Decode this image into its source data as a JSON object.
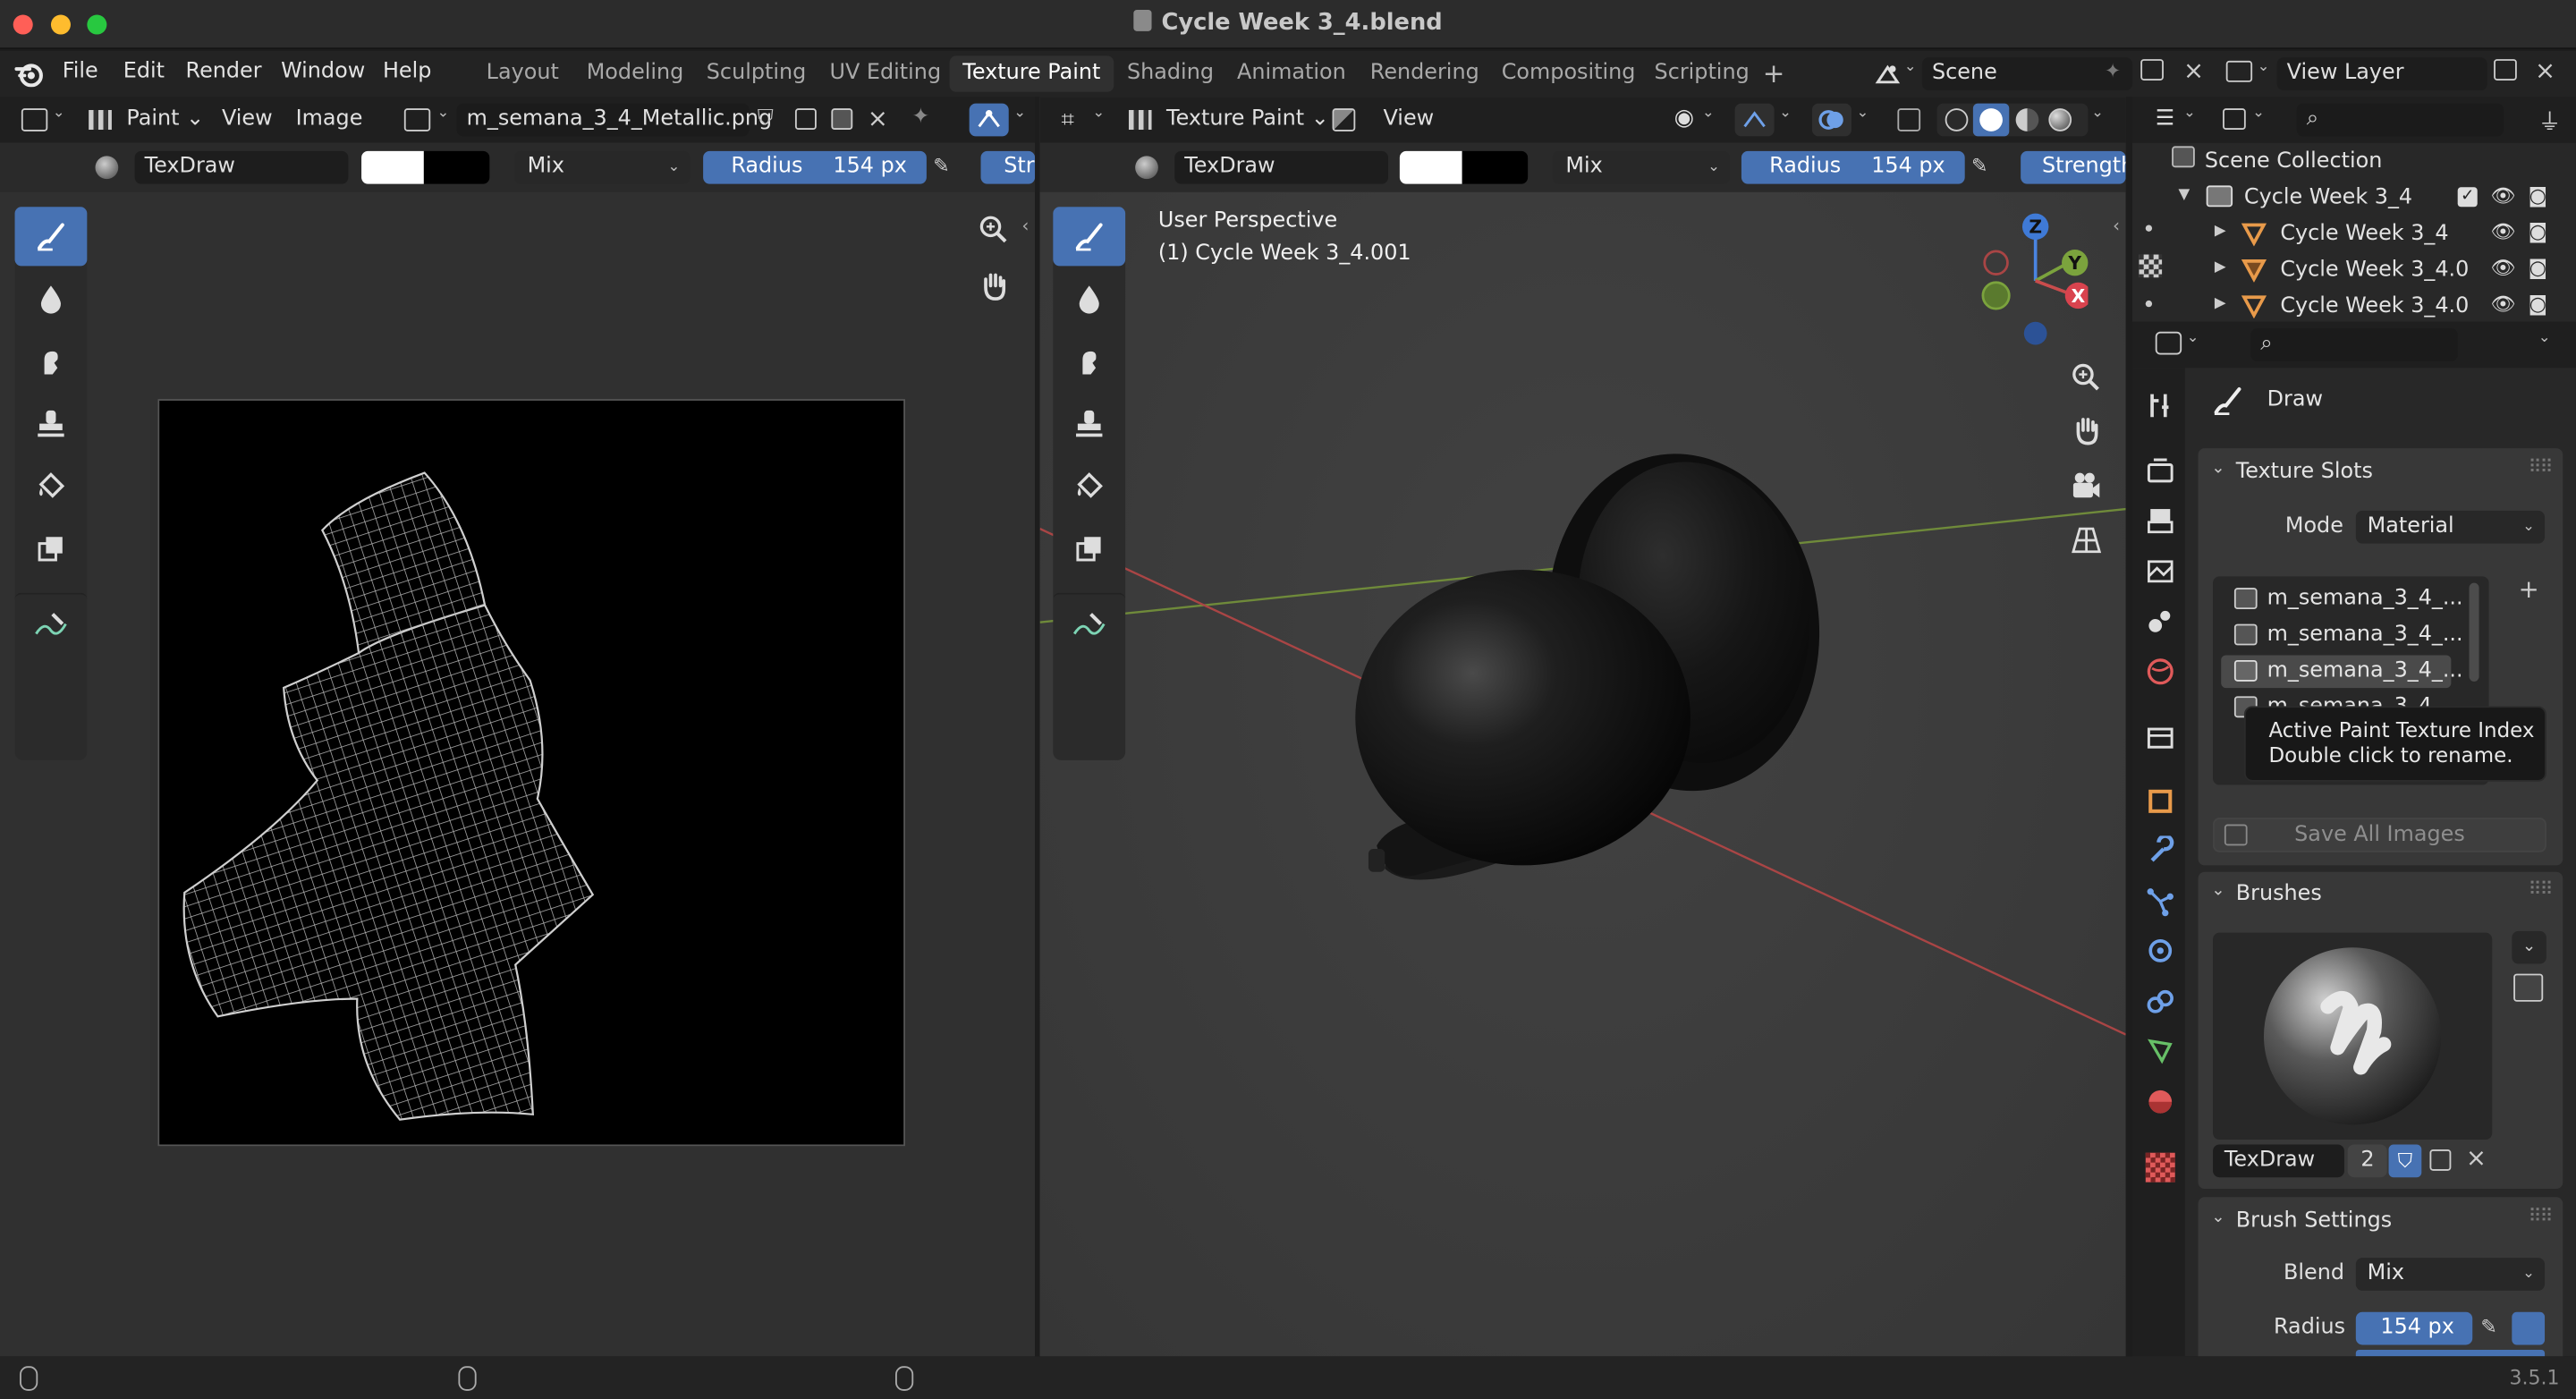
{
  "window": {
    "title": "Cycle Week 3_4.blend"
  },
  "menu": [
    "File",
    "Edit",
    "Render",
    "Window",
    "Help"
  ],
  "workspaces": [
    {
      "label": "Layout"
    },
    {
      "label": "Modeling"
    },
    {
      "label": "Sculpting"
    },
    {
      "label": "UV Editing"
    },
    {
      "label": "Texture Paint",
      "active": true
    },
    {
      "label": "Shading"
    },
    {
      "label": "Animation"
    },
    {
      "label": "Rendering"
    },
    {
      "label": "Compositing"
    },
    {
      "label": "Scripting"
    }
  ],
  "scene": {
    "name": "Scene"
  },
  "view_layer": {
    "name": "View Layer"
  },
  "image_editor": {
    "mode": "Paint",
    "menus": [
      "View",
      "Image"
    ],
    "image_name": "m_semana_3_4_Metallic.png",
    "brush": "TexDraw",
    "blend": "Mix",
    "radius_label": "Radius",
    "radius_value": "154 px",
    "strength_label": "Str"
  },
  "viewport": {
    "mode": "Texture Paint",
    "menus": [
      "View"
    ],
    "brush": "TexDraw",
    "blend": "Mix",
    "radius_label": "Radius",
    "radius_value": "154 px",
    "strength_label": "Strength",
    "perspective": "User Perspective",
    "object": "(1) Cycle Week 3_4.001",
    "gizmo": {
      "z": "Z",
      "y": "Y",
      "x": "X"
    }
  },
  "outliner": {
    "root": "Scene Collection",
    "collection": "Cycle Week 3_4",
    "objects": [
      "Cycle Week 3_4",
      "Cycle Week 3_4.0",
      "Cycle Week 3_4.0"
    ]
  },
  "properties": {
    "tool_name": "Draw",
    "texture_slots": {
      "title": "Texture Slots",
      "mode_label": "Mode",
      "mode_value": "Material",
      "slots": [
        "m_semana_3_4_...",
        "m_semana_3_4_...",
        "m_semana_3_4_...",
        "m_semana_3_4_..."
      ],
      "active_index": 2,
      "save_all": "Save All Images"
    },
    "tooltip": {
      "line1": "Active Paint Texture Index",
      "line2": "Double click to rename."
    },
    "brushes": {
      "title": "Brushes",
      "name": "TexDraw",
      "users": "2"
    },
    "brush_settings": {
      "title": "Brush Settings",
      "blend_label": "Blend",
      "blend_value": "Mix",
      "radius_label": "Radius",
      "radius_value": "154 px"
    }
  },
  "status": {
    "version": "3.5.1"
  },
  "colors": {
    "accent": "#4772b3",
    "panel": "#303030",
    "header": "#252525",
    "x_axis": "#c94c4c",
    "y_axis": "#7ba33d"
  }
}
